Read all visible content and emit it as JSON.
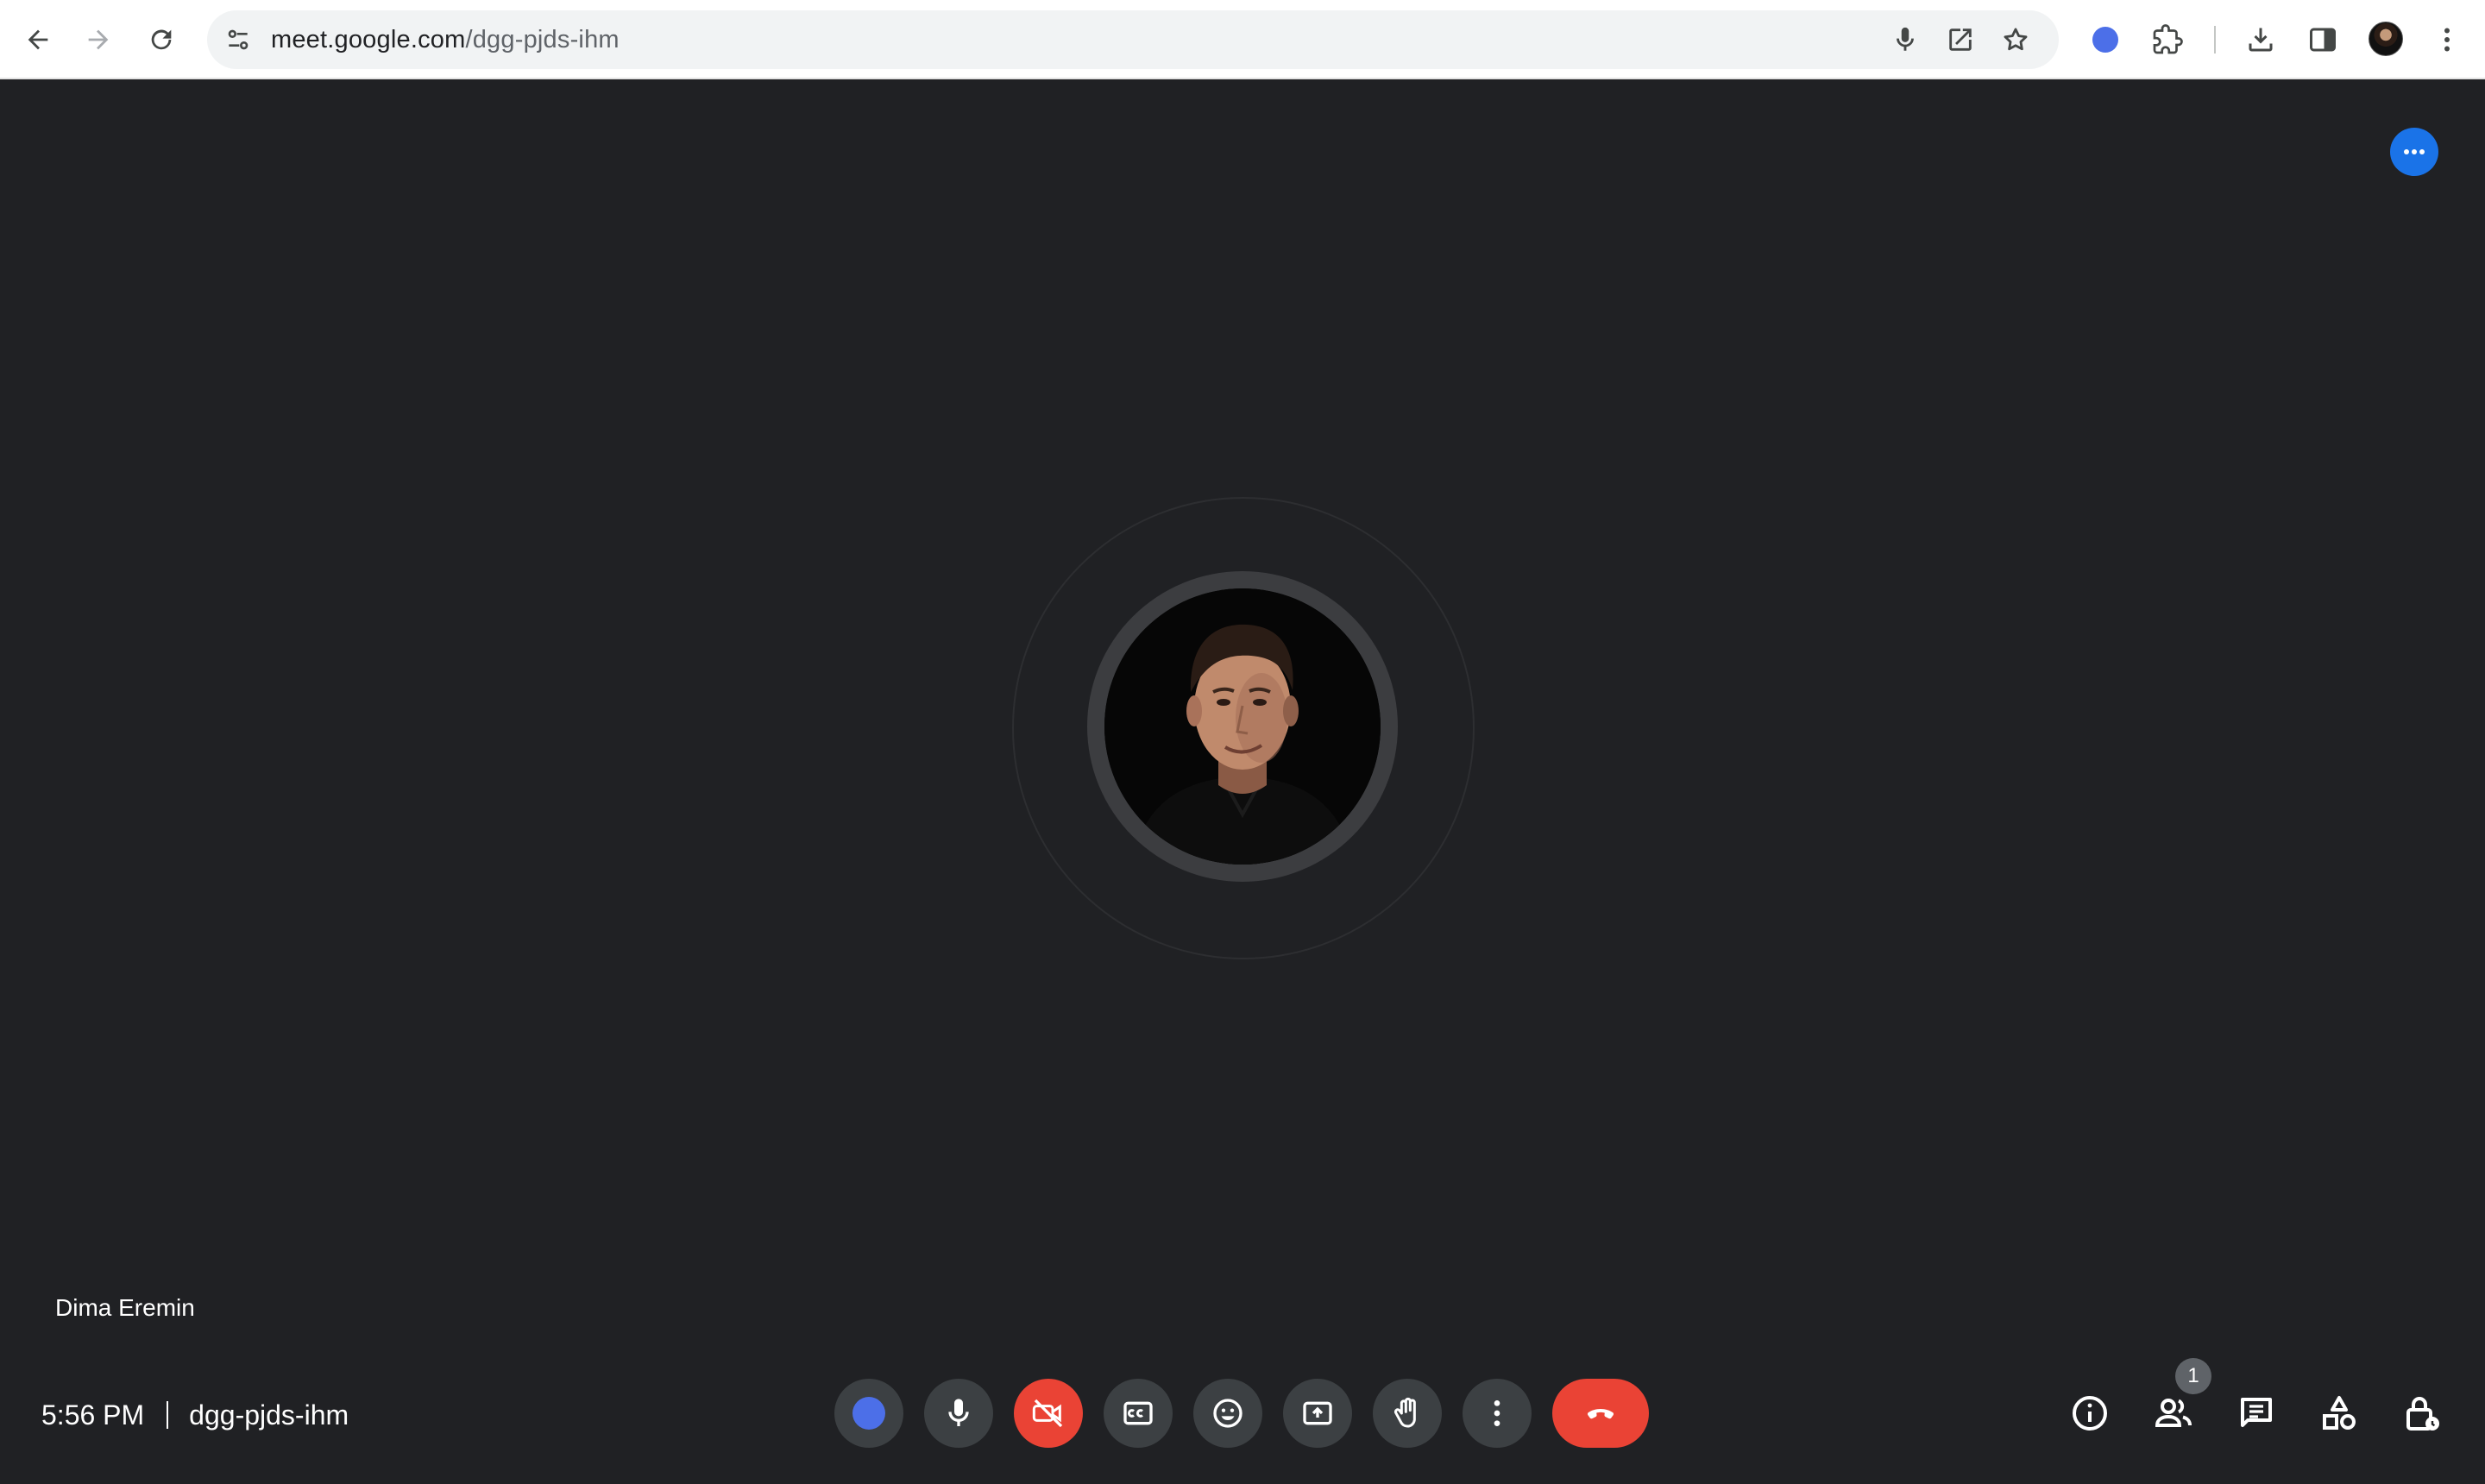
{
  "browser": {
    "url_host": "meet.google.com",
    "url_path": "/dgg-pjds-ihm"
  },
  "stage": {
    "participant_name": "Dima Eremin"
  },
  "bottom_bar": {
    "time": "5:56 PM",
    "meeting_code": "dgg-pjds-ihm",
    "participants_count": "1"
  },
  "colors": {
    "background": "#202124",
    "control": "#3c4043",
    "danger": "#ea4335",
    "accent": "#1a73e8"
  },
  "icons": [
    "back-icon",
    "forward-icon",
    "reload-icon",
    "site-info-icon",
    "mic-icon",
    "open-external-icon",
    "bookmark-star-icon",
    "extension-blue-dot-icon",
    "puzzle-icon",
    "download-icon",
    "side-panel-icon",
    "profile-avatar",
    "browser-menu-icon",
    "more-options-icon",
    "camera-off-icon",
    "captions-icon",
    "emoji-icon",
    "present-icon",
    "raise-hand-icon",
    "more-vert-icon",
    "end-call-icon",
    "info-icon",
    "people-icon",
    "chat-icon",
    "activities-icon",
    "host-controls-icon"
  ]
}
